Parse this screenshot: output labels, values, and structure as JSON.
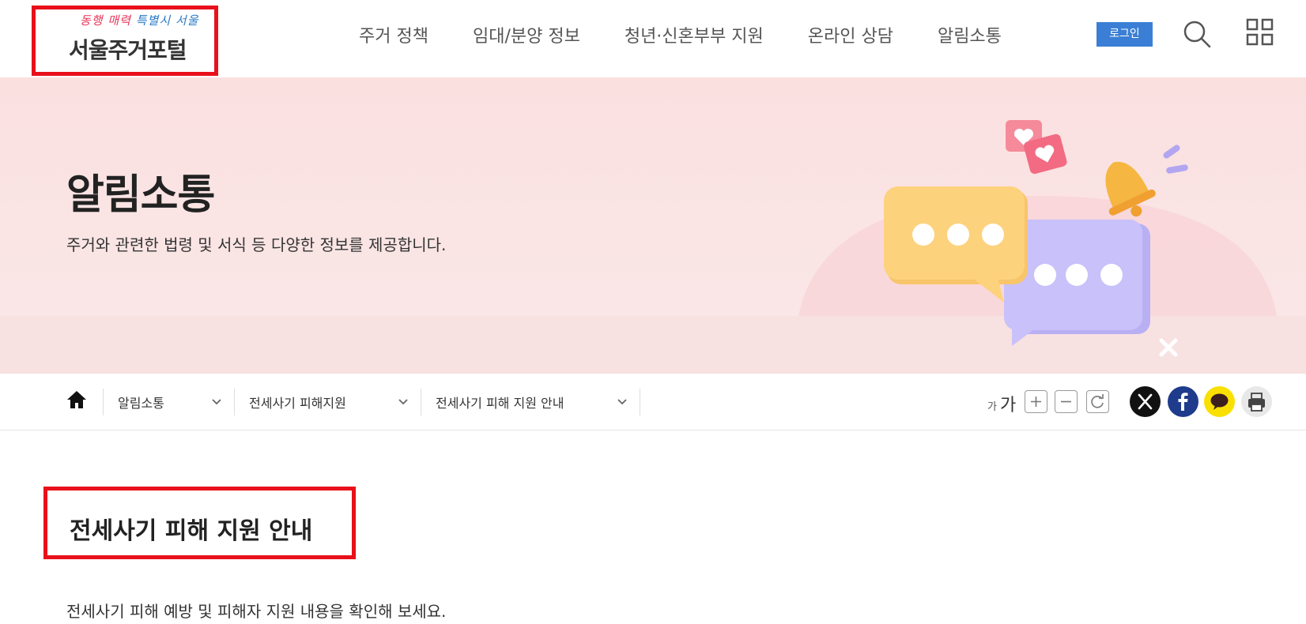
{
  "header": {
    "logo_slogan_red": "동행 매력",
    "logo_slogan_blue": "특별시 서울",
    "logo_title": "서울주거포털",
    "nav": [
      "주거 정책",
      "임대/분양 정보",
      "청년·신혼부부 지원",
      "온라인 상담",
      "알림소통"
    ],
    "login_label": "로그인",
    "icons": [
      "search-icon",
      "grid-menu-icon"
    ]
  },
  "banner": {
    "title": "알림소통",
    "description": "주거와 관련한 법령 및 서식 등 다양한 정보를 제공합니다."
  },
  "location": {
    "breadcrumbs": [
      "알림소통",
      "전세사기 피해지원",
      "전세사기 피해 지원 안내"
    ],
    "font_small": "가",
    "font_large": "가",
    "colors": {
      "x": "#111111",
      "facebook": "#1f3b8c",
      "kakao": "#f9e000",
      "print": "#e8e8e8",
      "login": "#3a7fd5",
      "highlight": "#e8101a"
    }
  },
  "content": {
    "title": "전세사기 피해 지원 안내",
    "description": "전세사기 피해 예방 및 피해자 지원 내용을 확인해 보세요."
  }
}
